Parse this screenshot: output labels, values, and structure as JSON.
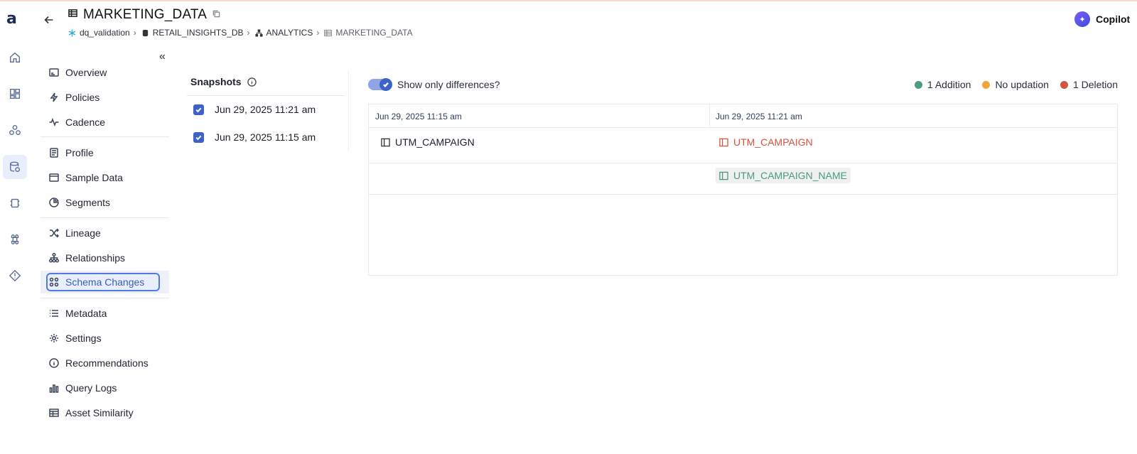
{
  "header": {
    "title": "MARKETING_DATA",
    "breadcrumbs": [
      "dq_validation",
      "RETAIL_INSIGHTS_DB",
      "ANALYTICS",
      "MARKETING_DATA"
    ]
  },
  "copilot": {
    "label": "Copilot"
  },
  "rail": {
    "icons": [
      "home-icon",
      "dashboard-icon",
      "graph-icon",
      "database-icon",
      "chip-icon",
      "command-icon",
      "alert-icon"
    ]
  },
  "nav": {
    "items": [
      {
        "label": "Overview",
        "icon": "overview-icon"
      },
      {
        "label": "Policies",
        "icon": "bolt-icon"
      },
      {
        "label": "Cadence",
        "icon": "pulse-icon"
      },
      {
        "label": "Profile",
        "icon": "profile-icon"
      },
      {
        "label": "Sample Data",
        "icon": "sample-icon"
      },
      {
        "label": "Segments",
        "icon": "pie-icon"
      },
      {
        "label": "Lineage",
        "icon": "shuffle-icon"
      },
      {
        "label": "Relationships",
        "icon": "hierarchy-icon"
      },
      {
        "label": "Schema Changes",
        "icon": "grid-dots-icon",
        "active": true
      },
      {
        "label": "Metadata",
        "icon": "list-icon"
      },
      {
        "label": "Settings",
        "icon": "gear-icon"
      },
      {
        "label": "Recommendations",
        "icon": "info-icon"
      },
      {
        "label": "Query Logs",
        "icon": "bars-icon"
      },
      {
        "label": "Asset Similarity",
        "icon": "table-icon"
      }
    ]
  },
  "snapshots": {
    "title": "Snapshots",
    "items": [
      {
        "label": "Jun 29, 2025 11:21 am",
        "checked": true
      },
      {
        "label": "Jun 29, 2025 11:15 am",
        "checked": true
      }
    ]
  },
  "toggle": {
    "label": "Show only differences?",
    "on": true
  },
  "legend": [
    {
      "label": "1 Addition",
      "color": "#4a9e7d"
    },
    {
      "label": "No updation",
      "color": "#f0a63a"
    },
    {
      "label": "1 Deletion",
      "color": "#d2533f"
    }
  ],
  "diff": {
    "columns": [
      "Jun 29, 2025 11:15 am",
      "Jun 29, 2025 11:21 am"
    ],
    "rows": [
      {
        "left": "UTM_CAMPAIGN",
        "right": "UTM_CAMPAIGN",
        "right_status": "deletion"
      },
      {
        "left": "",
        "right": "UTM_CAMPAIGN_NAME",
        "right_status": "addition"
      }
    ]
  }
}
